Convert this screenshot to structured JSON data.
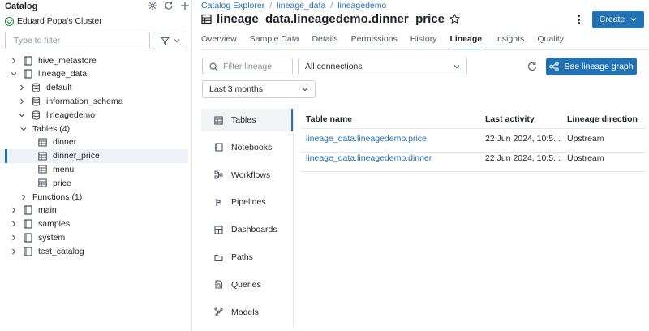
{
  "sidebar": {
    "title": "Catalog",
    "header_icons": [
      "gear-icon",
      "refresh-icon",
      "plus-icon"
    ],
    "cluster": "Eduard Popa's Cluster",
    "filter_placeholder": "Type to filter",
    "tree": [
      {
        "label": "hive_metastore",
        "level": 0,
        "icon": "catalog-icon",
        "expanded": false
      },
      {
        "label": "lineage_data",
        "level": 0,
        "icon": "catalog-icon",
        "expanded": true
      },
      {
        "label": "default",
        "level": 1,
        "icon": "schema-icon",
        "expanded": false
      },
      {
        "label": "information_schema",
        "level": 1,
        "icon": "schema-icon",
        "expanded": false
      },
      {
        "label": "lineagedemo",
        "level": 1,
        "icon": "schema-icon",
        "expanded": true
      },
      {
        "label": "Tables (4)",
        "level": 2,
        "icon": "",
        "expanded": true
      },
      {
        "label": "dinner",
        "level": 3,
        "icon": "table-icon"
      },
      {
        "label": "dinner_price",
        "level": 3,
        "icon": "table-icon",
        "selected": true
      },
      {
        "label": "menu",
        "level": 3,
        "icon": "table-icon"
      },
      {
        "label": "price",
        "level": 3,
        "icon": "table-icon"
      },
      {
        "label": "Functions (1)",
        "level": 2,
        "icon": "",
        "expanded": false
      },
      {
        "label": "main",
        "level": 0,
        "icon": "catalog-icon",
        "expanded": false
      },
      {
        "label": "samples",
        "level": 0,
        "icon": "catalog-icon",
        "expanded": false
      },
      {
        "label": "system",
        "level": 0,
        "icon": "catalog-icon",
        "expanded": false
      },
      {
        "label": "test_catalog",
        "level": 0,
        "icon": "catalog-icon",
        "expanded": false
      }
    ]
  },
  "breadcrumb": [
    "Catalog Explorer",
    "lineage_data",
    "lineagedemo"
  ],
  "page_title": "lineage_data.lineagedemo.dinner_price",
  "create_label": "Create",
  "tabs": [
    {
      "label": "Overview",
      "active": false
    },
    {
      "label": "Sample Data",
      "active": false
    },
    {
      "label": "Details",
      "active": false
    },
    {
      "label": "Permissions",
      "active": false
    },
    {
      "label": "History",
      "active": false
    },
    {
      "label": "Lineage",
      "active": true
    },
    {
      "label": "Insights",
      "active": false
    },
    {
      "label": "Quality",
      "active": false
    }
  ],
  "lineage": {
    "filter_placeholder": "Filter lineage",
    "connections_value": "All connections",
    "time_value": "Last 3 months",
    "graph_button": "See lineage graph",
    "nav": [
      {
        "label": "Tables",
        "icon": "table-icon",
        "active": true
      },
      {
        "label": "Notebooks",
        "icon": "notebook-icon"
      },
      {
        "label": "Workflows",
        "icon": "workflow-icon"
      },
      {
        "label": "Pipelines",
        "icon": "pipeline-icon"
      },
      {
        "label": "Dashboards",
        "icon": "dashboard-icon"
      },
      {
        "label": "Paths",
        "icon": "folder-icon"
      },
      {
        "label": "Queries",
        "icon": "query-icon"
      },
      {
        "label": "Models",
        "icon": "model-icon"
      }
    ],
    "columns": [
      "Table name",
      "Last activity",
      "Lineage direction"
    ],
    "rows": [
      {
        "name": "lineage_data.lineagedemo.price",
        "activity": "22 Jun 2024, 10:5...",
        "direction": "Upstream"
      },
      {
        "name": "lineage_data.lineagedemo.dinner",
        "activity": "22 Jun 2024, 10:5...",
        "direction": "Upstream"
      }
    ]
  }
}
